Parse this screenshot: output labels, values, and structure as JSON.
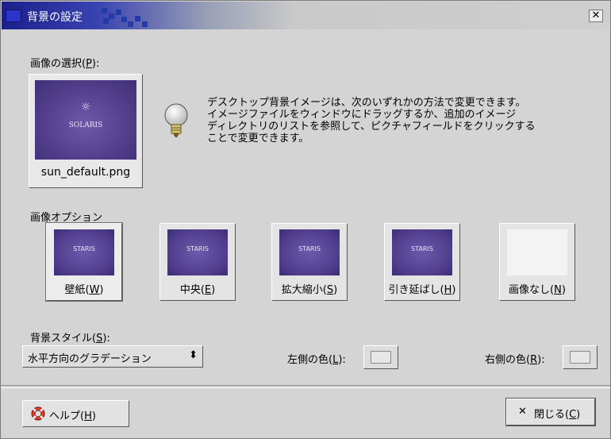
{
  "window": {
    "title": "背景の設定"
  },
  "picture": {
    "label": "画像の選択(",
    "mnemonic": "P",
    "label_end": "):",
    "filename": "sun_default.png",
    "logo_text": "SOLARIS"
  },
  "hint": {
    "line1": "デスクトップ背景イメージは、次のいずれかの方法で変更できます。",
    "line2": "イメージファイルをウィンドウにドラッグするか、追加のイメージ",
    "line3": "ディレクトリのリストを参照して、ピクチャフィールドをクリックする",
    "line4": "ことで変更できます。"
  },
  "options": {
    "label": "画像オプション",
    "items": [
      {
        "name": "壁紙(",
        "mnemonic": "W",
        "end": ")",
        "selected": true
      },
      {
        "name": "中央(",
        "mnemonic": "E",
        "end": ")"
      },
      {
        "name": "拡大縮小(",
        "mnemonic": "S",
        "end": ")"
      },
      {
        "name": "引き延ばし(",
        "mnemonic": "H",
        "end": ")"
      },
      {
        "name": "画像なし(",
        "mnemonic": "N",
        "end": ")"
      }
    ],
    "thumb_text": "STARIS"
  },
  "style": {
    "label": "背景スタイル(",
    "mnemonic": "S",
    "label_end": "):",
    "value": "水平方向のグラデーション"
  },
  "colors": {
    "left": {
      "label": "左側の色(",
      "mnemonic": "L",
      "end": "):"
    },
    "right": {
      "label": "右側の色(",
      "mnemonic": "R",
      "end": "):"
    }
  },
  "buttons": {
    "help": {
      "label": "ヘルプ(",
      "mnemonic": "H",
      "end": ")"
    },
    "close": {
      "label": "閉じる(",
      "mnemonic": "C",
      "end": ")"
    }
  }
}
